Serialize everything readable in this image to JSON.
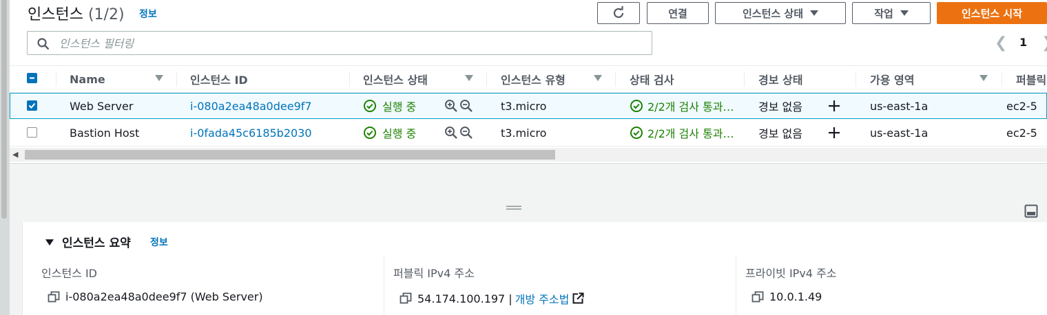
{
  "header": {
    "title": "인스턴스",
    "count": "(1/2)",
    "info": "정보"
  },
  "toolbar": {
    "connect": "연결",
    "instance_state": "인스턴스 상태",
    "actions": "작업",
    "launch": "인스턴스 시작"
  },
  "search": {
    "placeholder": "인스턴스 필터링"
  },
  "pagination": {
    "page": "1"
  },
  "table": {
    "columns": [
      "Name",
      "인스턴스 ID",
      "인스턴스 상태",
      "인스턴스 유형",
      "상태 검사",
      "경보 상태",
      "가용 영역",
      "퍼블릭"
    ],
    "rows": [
      {
        "selected": true,
        "name": "Web Server",
        "id": "i-080a2ea48a0dee9f7",
        "state": "실행 중",
        "type": "t3.micro",
        "check": "2/2개 검사 통과…",
        "alarm": "경보 없음",
        "az": "us-east-1a",
        "public": "ec2-5"
      },
      {
        "selected": false,
        "name": "Bastion Host",
        "id": "i-0fada45c6185b2030",
        "state": "실행 중",
        "type": "t3.micro",
        "check": "2/2개 검사 통과…",
        "alarm": "경보 없음",
        "az": "us-east-1a",
        "public": "ec2-5"
      }
    ]
  },
  "summary": {
    "title": "인스턴스 요약",
    "info": "정보",
    "instance_id_label": "인스턴스 ID",
    "instance_id_value": "i-080a2ea48a0dee9f7 (Web Server)",
    "public_ip_label": "퍼블릭 IPv4 주소",
    "public_ip_value": "54.174.100.197",
    "public_ip_separator": "|",
    "open_address_link": "개방 주소법",
    "private_ip_label": "프라이빗 IPv4 주소",
    "private_ip_value": "10.0.1.49"
  },
  "colors": {
    "accent": "#0073bb",
    "primary_button": "#ec7211",
    "success": "#1d8102"
  }
}
